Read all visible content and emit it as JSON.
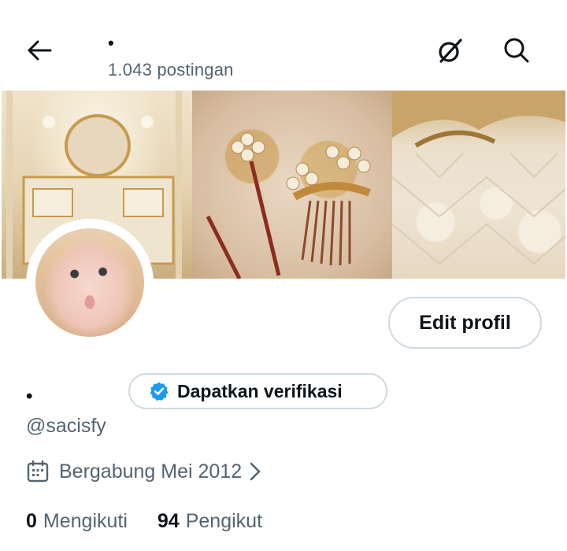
{
  "header": {
    "display_name": "•",
    "post_count": "1.043 postingan",
    "back_icon": "arrow-left-icon",
    "grok_icon": "grok-icon",
    "search_icon": "search-icon"
  },
  "banner": {
    "panels": [
      "vanity-photo",
      "gold-hairpins-photo",
      "tufted-headboard-photo"
    ]
  },
  "profile": {
    "display_name": "•",
    "handle": "@sacisfy",
    "edit_button_label": "Edit profil",
    "verify_button_label": "Dapatkan verifikasi",
    "verified_badge_color": "#1d9bf0",
    "joined_text": "Bergabung Mei 2012",
    "following_count": "0",
    "following_label": "Mengikuti",
    "followers_count": "94",
    "followers_label": "Pengikut"
  },
  "colors": {
    "text_primary": "#0f1419",
    "text_secondary": "#536471",
    "border": "#cfd9de",
    "accent": "#1d9bf0"
  }
}
